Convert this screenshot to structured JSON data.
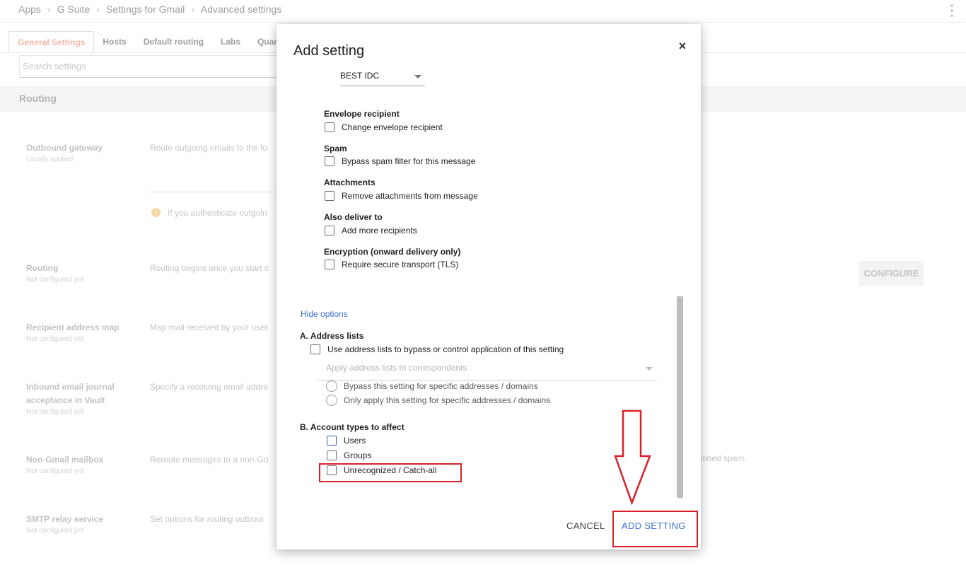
{
  "breadcrumbs": [
    "Apps",
    "G Suite",
    "Settings for Gmail",
    "Advanced settings"
  ],
  "tabs": [
    "General Settings",
    "Hosts",
    "Default routing",
    "Labs",
    "Quaran"
  ],
  "search_placeholder": "Search settings",
  "section": "Routing",
  "rows": [
    {
      "name": "Outbound gateway",
      "sub": "Locally applied",
      "desc": "Route outgoing emails to the fo"
    },
    {
      "name": "Routing",
      "sub": "Not configured yet",
      "desc": "Routing begins once you start c"
    },
    {
      "name": "Recipient address map",
      "sub": "Not configured yet",
      "desc": "Map mail received by your user"
    },
    {
      "name": "Inbound email journal acceptance in Vault",
      "sub": "Not configured yet",
      "desc": "Specify a receiving email addre"
    },
    {
      "name": "Non-Gmail mailbox",
      "sub": "Not configured yet",
      "desc": "Reroute messages to a non-Go"
    },
    {
      "name": "SMTP relay service",
      "sub": "Not configured yet",
      "desc": "Set options for routing outbour"
    }
  ],
  "info_text": "If you authenticate outgoin",
  "configure_label": "CONFIGURE",
  "right_text": "ntined spam.",
  "dialog": {
    "title": "Add setting",
    "close": "×",
    "select_value": "BEST IDC",
    "groups": [
      {
        "label": "Envelope recipient",
        "option": "Change envelope recipient"
      },
      {
        "label": "Spam",
        "option": "Bypass spam filter for this message"
      },
      {
        "label": "Attachments",
        "option": "Remove attachments from message"
      },
      {
        "label": "Also deliver to",
        "option": "Add more recipients"
      },
      {
        "label": "Encryption (onward delivery only)",
        "option": "Require secure transport (TLS)"
      }
    ],
    "hide_options": "Hide options",
    "section_a": {
      "title": "A. Address lists",
      "checkbox": "Use address lists to bypass or control application of this setting",
      "select_placeholder": "Apply address lists to correspondents",
      "radio_1": "Bypass this setting for specific addresses / domains",
      "radio_2": "Only apply this setting for specific addresses / domains"
    },
    "section_b": {
      "title": "B. Account types to affect",
      "options": [
        "Users",
        "Groups",
        "Unrecognized / Catch-all"
      ]
    },
    "cancel_label": "CANCEL",
    "add_label": "ADD SETTING"
  }
}
